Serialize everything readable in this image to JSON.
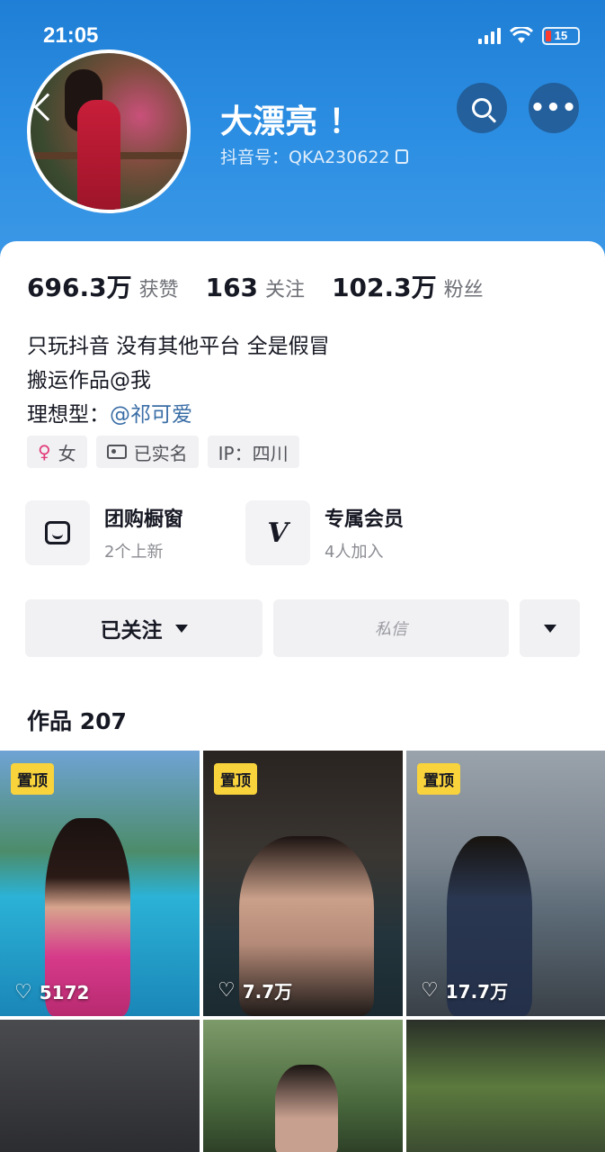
{
  "status_bar": {
    "time": "21:05",
    "battery": "15"
  },
  "profile": {
    "name": "大漂亮 ！",
    "douyin_id": "抖音号：QKA230622"
  },
  "stats": [
    {
      "value": "696.3万",
      "label": "获赞"
    },
    {
      "value": "163",
      "label": "关注"
    },
    {
      "value": "102.3万",
      "label": "粉丝"
    }
  ],
  "bio": {
    "line1": "只玩抖音 没有其他平台 全是假冒",
    "line2": "搬运作品@我",
    "line3_prefix": "理想型：",
    "line3_mention": "@祁可爱"
  },
  "tags": {
    "gender": "女",
    "verified": "已实名",
    "ip": "IP：四川"
  },
  "services": [
    {
      "title": "团购橱窗",
      "subtitle": "2个上新",
      "icon": "shop-icon"
    },
    {
      "title": "专属会员",
      "subtitle": "4人加入",
      "icon": "vip-icon"
    }
  ],
  "actions": {
    "follow": "已关注",
    "message": "私信"
  },
  "works": {
    "title": "作品 207",
    "items": [
      {
        "pinned": "置顶",
        "likes": "5172"
      },
      {
        "pinned": "置顶",
        "likes": "7.7万"
      },
      {
        "pinned": "置顶",
        "likes": "17.7万"
      },
      {
        "pinned": "",
        "likes": ""
      },
      {
        "pinned": "",
        "likes": ""
      },
      {
        "pinned": "",
        "likes": ""
      }
    ]
  }
}
